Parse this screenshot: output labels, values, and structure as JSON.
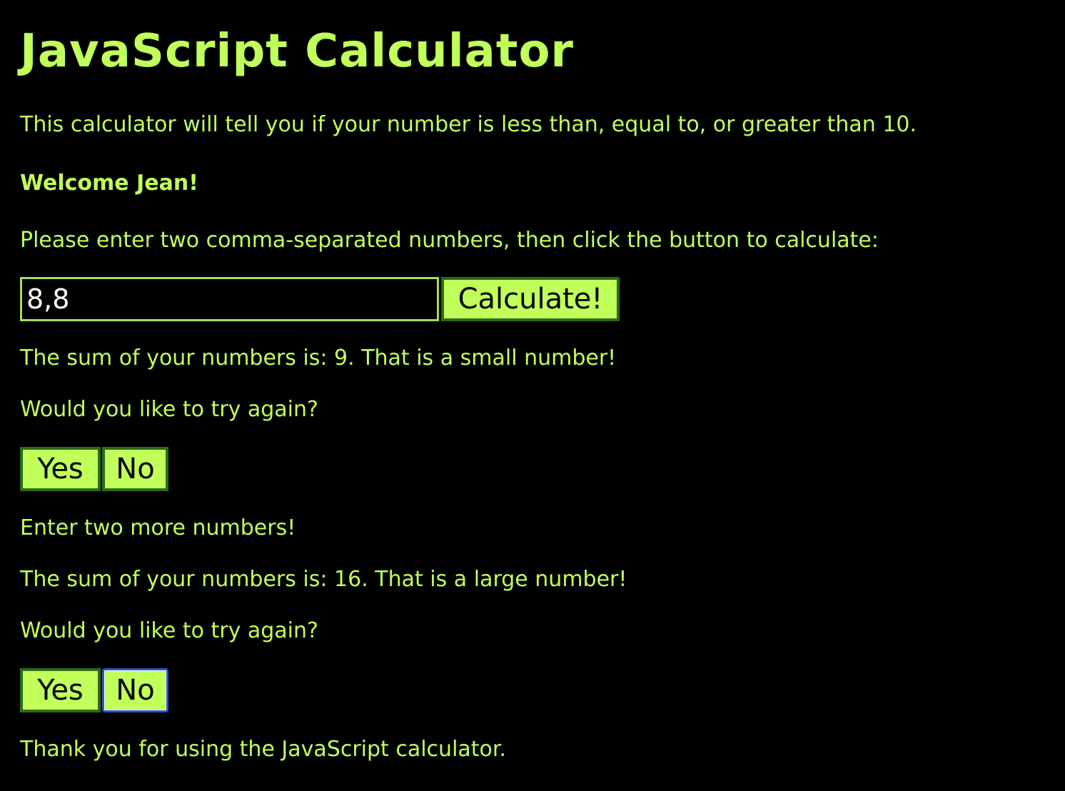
{
  "header": {
    "title": "JavaScript Calculator"
  },
  "intro": "This calculator will tell you if your number is less than, equal to, or greater than 10.",
  "welcome": "Welcome Jean!",
  "instructions": "Please enter two comma-separated numbers, then click the button to calculate:",
  "form": {
    "input_value": "8,8",
    "calculate_label": "Calculate!"
  },
  "results": [
    {
      "sum_message": "The sum of your numbers is: 9. That is a small number!",
      "prompt": "Would you like to try again?",
      "yes_label": "Yes",
      "no_label": "No"
    },
    {
      "sum_message": "The sum of your numbers is: 16. That is a large number!",
      "prompt": "Would you like to try again?",
      "yes_label": "Yes",
      "no_label": "No"
    }
  ],
  "more_numbers": "Enter two more numbers!",
  "closing": "Thank you for using the JavaScript calculator.",
  "colors": {
    "background": "#000000",
    "accent": "#c1ff5a",
    "button_border": "#2d6b1a",
    "focus_ring": "#2b55c8"
  }
}
